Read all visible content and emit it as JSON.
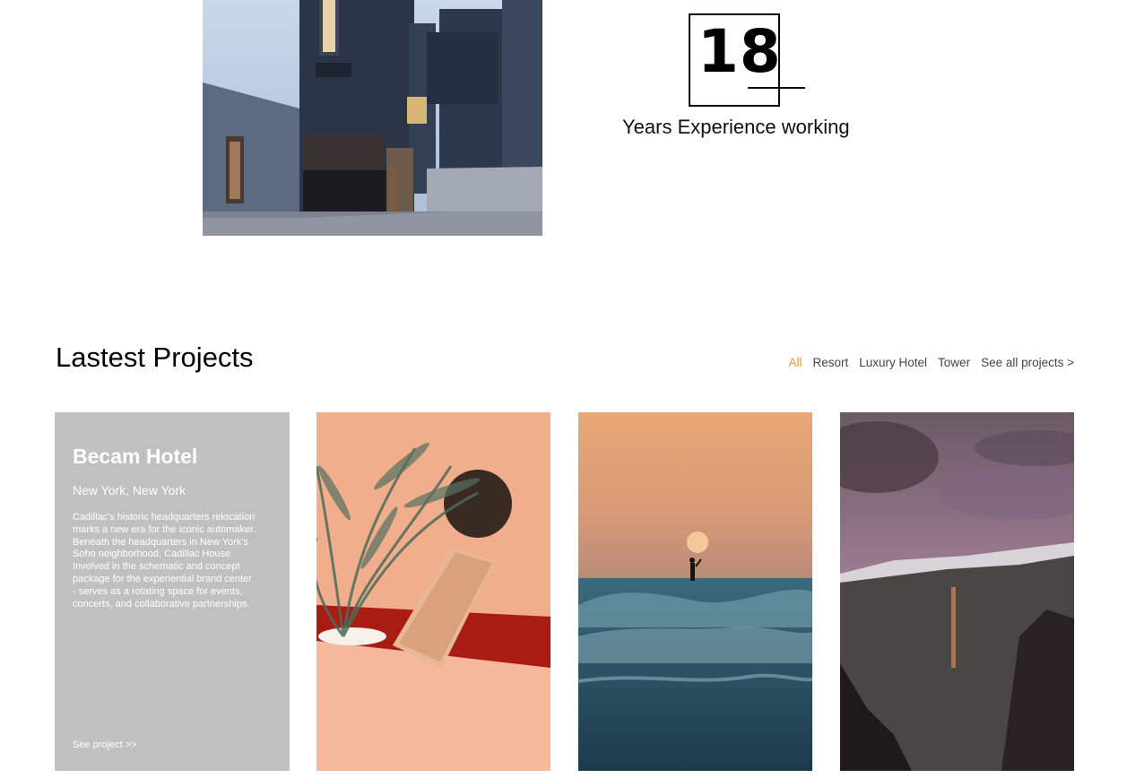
{
  "experience": {
    "number": "18",
    "caption": "Years Experience working"
  },
  "projects": {
    "title": "Lastest Projects",
    "filters": [
      {
        "label": "All",
        "active": true
      },
      {
        "label": "Resort",
        "active": false
      },
      {
        "label": "Luxury Hotel",
        "active": false
      },
      {
        "label": "Tower",
        "active": false
      },
      {
        "label": "See all projects >",
        "active": false
      }
    ],
    "featured": {
      "title": "Becam Hotel",
      "location": "New York, New York",
      "description": "Cadillac's historic headquarters relocation marks a new era for the iconic automaker. Beneath the headquarters in New York's Soho neighborhood, Cadillac House. Involved in the schematic and concept package for the experiential brand center - serves as a rotating space for events, concerts, and collaborative partnerships.",
      "link": "See project >>"
    }
  },
  "colors": {
    "accent": "#e8962e",
    "card_bg": "#c0c0c0"
  }
}
